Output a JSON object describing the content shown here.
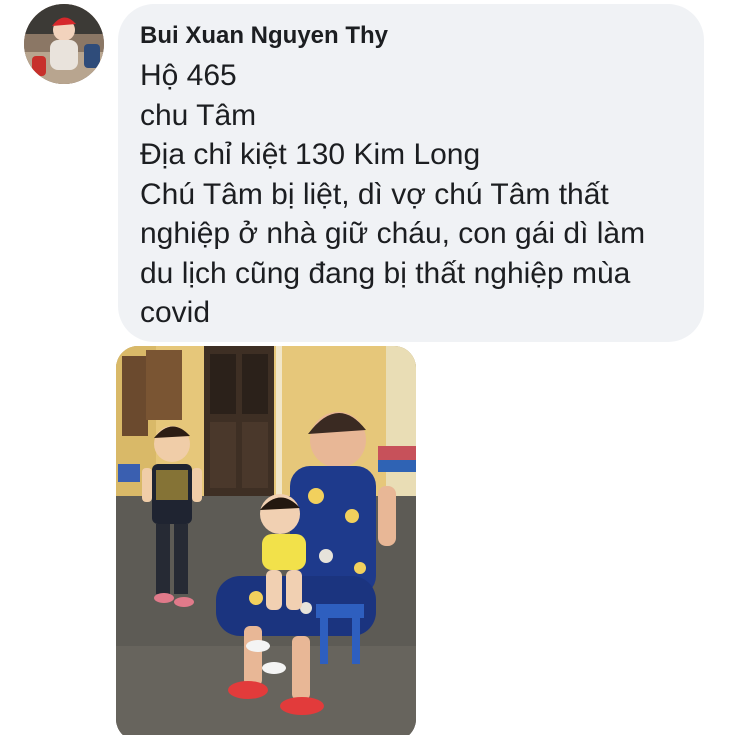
{
  "comment": {
    "author": "Bui Xuan Nguyen Thy",
    "lines": [
      "Hộ 465",
      "chu Tâm",
      "Địa chỉ kiệt 130 Kim Long",
      "Chú Tâm bị liệt, dì vợ chú Tâm thất",
      "nghiệp ở nhà giữ cháu, con gái dì làm",
      "du lịch cũng đang bị thất nghiệp mùa",
      "covid"
    ]
  },
  "colors": {
    "bubble": "#f0f2f5",
    "text": "#1c1e21"
  }
}
